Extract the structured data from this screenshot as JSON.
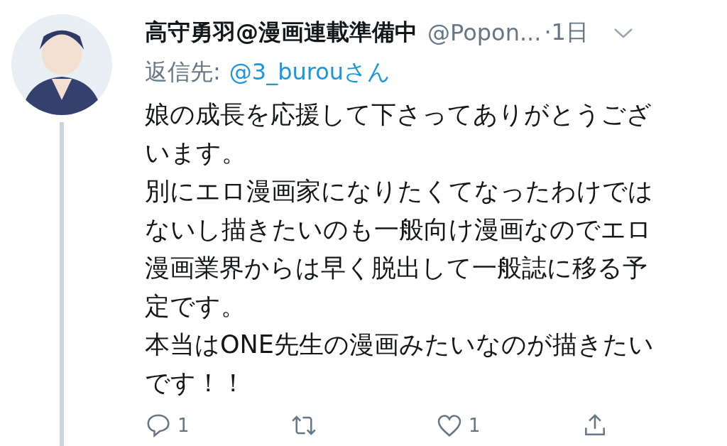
{
  "tweet": {
    "author": {
      "name": "高守勇羽@漫画連載準備中",
      "handle": "@Popon...",
      "time": "·1日"
    },
    "reply_to": {
      "label": "返信先:",
      "user": "@3_burouさん"
    },
    "body_lines": [
      "娘の成長を応援して下さってありがとうござ",
      "います。",
      "別にエロ漫画家になりたくてなったわけでは",
      "ないし描きたいのも一般向け漫画なのでエロ",
      "漫画業界からは早く脱出して一般誌に移る予",
      "定です。",
      "本当はONE先生の漫画みたいなのが描きたい",
      "です！！"
    ],
    "actions": [
      {
        "kind": "reply",
        "count": "1"
      },
      {
        "kind": "retweet"
      },
      {
        "kind": "like",
        "count": "1"
      },
      {
        "kind": "share"
      }
    ]
  }
}
